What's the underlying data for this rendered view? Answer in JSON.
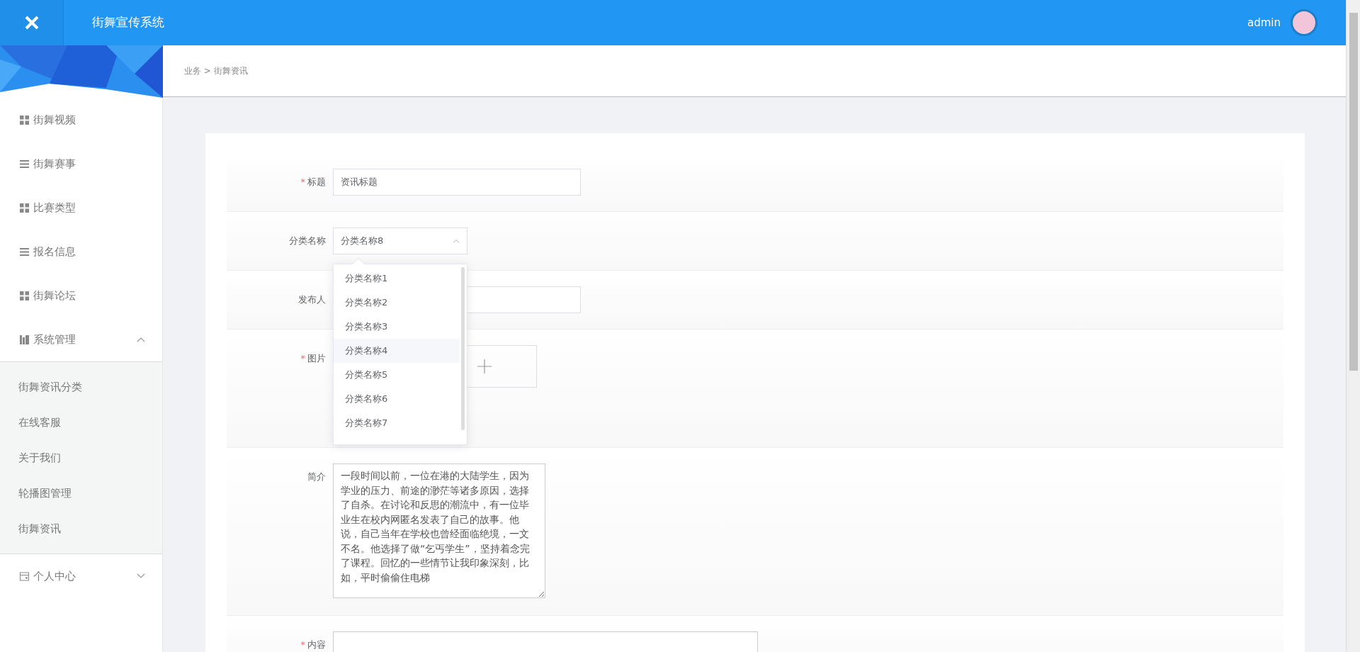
{
  "header": {
    "title": "街舞宣传系统",
    "user": "admin"
  },
  "breadcrumb": "业务 > 街舞资讯",
  "sidebar": {
    "items": [
      {
        "label": "街舞视频",
        "kind": "grid"
      },
      {
        "label": "街舞赛事",
        "kind": "list"
      },
      {
        "label": "比赛类型",
        "kind": "grid"
      },
      {
        "label": "报名信息",
        "kind": "list"
      },
      {
        "label": "街舞论坛",
        "kind": "grid"
      },
      {
        "label": "系统管理",
        "kind": "chart",
        "expanded": true,
        "children": [
          {
            "label": "街舞资讯分类"
          },
          {
            "label": "在线客服"
          },
          {
            "label": "关于我们"
          },
          {
            "label": "轮播图管理"
          },
          {
            "label": "街舞资讯"
          }
        ]
      },
      {
        "label": "个人中心",
        "kind": "card",
        "expanded": false
      }
    ]
  },
  "form": {
    "required_mark": "*",
    "fields": [
      {
        "kind": "text",
        "label": "标题",
        "required": true,
        "value": "资讯标题"
      },
      {
        "kind": "select",
        "label": "分类名称",
        "required": false,
        "value": "分类名称8",
        "open": true,
        "options": [
          {
            "label": "分类名称1",
            "hovered": false
          },
          {
            "label": "分类名称2",
            "hovered": false
          },
          {
            "label": "分类名称3",
            "hovered": false
          },
          {
            "label": "分类名称4",
            "hovered": true
          },
          {
            "label": "分类名称5",
            "hovered": false
          },
          {
            "label": "分类名称6",
            "hovered": false
          },
          {
            "label": "分类名称7",
            "hovered": false
          }
        ]
      },
      {
        "kind": "text",
        "label": "发布人",
        "required": false
      },
      {
        "kind": "upload",
        "label": "图片",
        "required": true
      },
      {
        "kind": "textarea",
        "label": "简介",
        "required": false,
        "value": "一段时间以前，一位在港的大陆学生，因为学业的压力、前途的渺茫等诸多原因，选择了自杀。在讨论和反思的潮流中，有一位毕业生在校内网匿名发表了自己的故事。他说，自己当年在学校也曾经面临绝境，一文不名。他选择了做“乞丐学生”，坚持着念完了课程。回忆的一些情节让我印象深刻，比如，平时偷偷住电梯"
      },
      {
        "kind": "editor",
        "label": "内容",
        "required": true
      }
    ]
  }
}
